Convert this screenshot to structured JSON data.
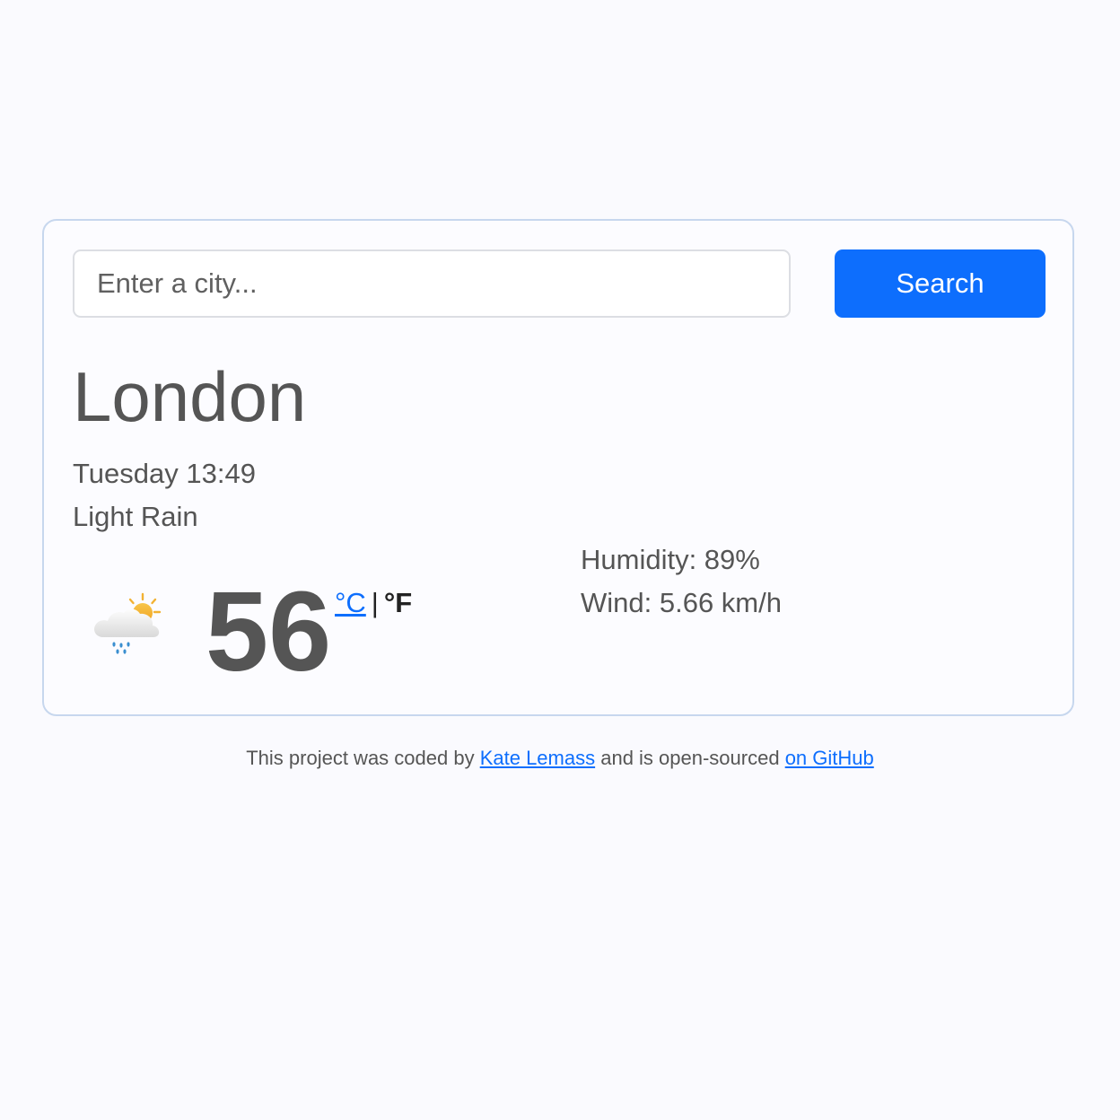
{
  "search": {
    "placeholder": "Enter a city...",
    "value": "",
    "button_label": "Search"
  },
  "weather": {
    "city": "London",
    "datetime": "Tuesday 13:49",
    "description": "Light Rain",
    "icon": "rain-partly-sunny-icon",
    "temperature": "56",
    "unit_celsius": "°C",
    "unit_separator": "|",
    "unit_fahrenheit": "°F",
    "humidity": "Humidity: 89%",
    "wind": "Wind: 5.66 km/h"
  },
  "footer": {
    "text_1": "This project was coded by ",
    "author_link": "Kate Lemass",
    "text_2": " and is open-sourced ",
    "github_link": "on GitHub"
  },
  "colors": {
    "accent": "#0d6efd",
    "text": "#555555",
    "card_border": "#c7d7ee",
    "background": "#fafafe"
  }
}
